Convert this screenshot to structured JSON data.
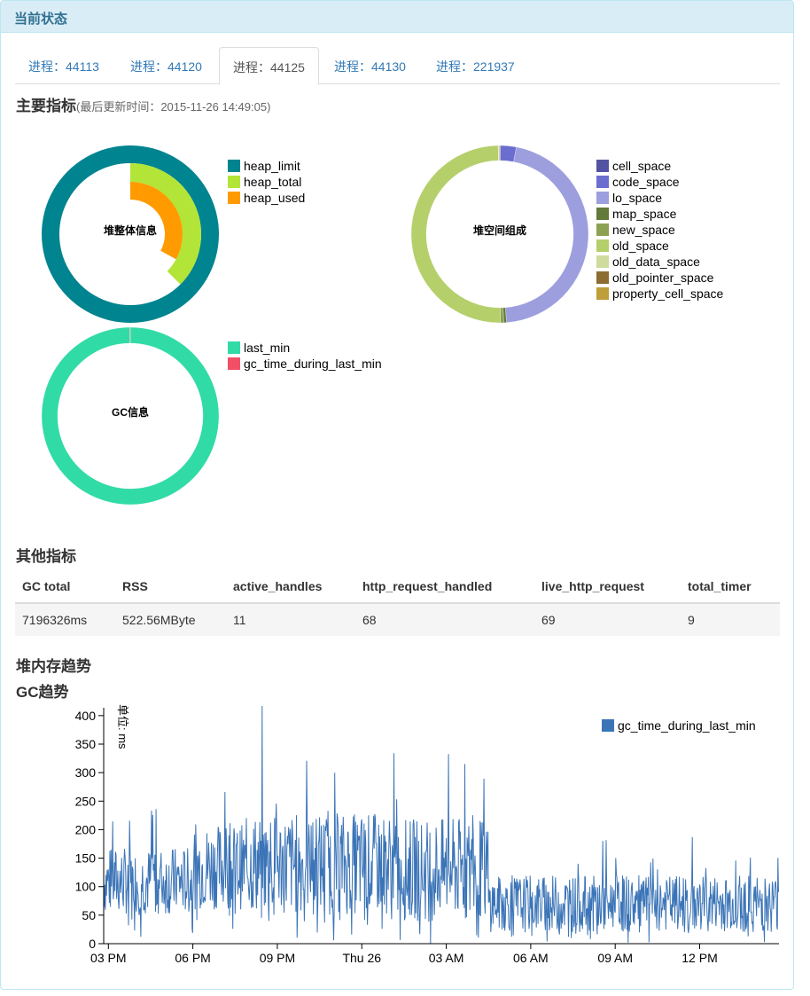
{
  "panel": {
    "title": "当前状态"
  },
  "tabs": [
    {
      "label": "进程：44113",
      "active": false
    },
    {
      "label": "进程：44120",
      "active": false
    },
    {
      "label": "进程：44125",
      "active": true
    },
    {
      "label": "进程：44130",
      "active": false
    },
    {
      "label": "进程：221937",
      "active": false
    }
  ],
  "main_metrics": {
    "title": "主要指标",
    "updated": "(最后更新时间：2015-11-26 14:49:05)"
  },
  "other_metrics": {
    "title": "其他指标",
    "columns": [
      "GC total",
      "RSS",
      "active_handles",
      "http_request_handled",
      "live_http_request",
      "total_timer"
    ],
    "row": [
      "7196326ms",
      "522.56MByte",
      "11",
      "68",
      "69",
      "9"
    ]
  },
  "heap_trend": {
    "title": "堆内存趋势"
  },
  "gc_trend": {
    "title": "GC趋势"
  },
  "chart_data": [
    {
      "type": "pie",
      "title": "堆整体信息",
      "legend_position": "right",
      "series": [
        {
          "name": "heap_limit",
          "values": [
            1.0
          ],
          "color": "#00848f"
        },
        {
          "name": "heap_total",
          "values": [
            0.375
          ],
          "color": "#b2e537"
        },
        {
          "name": "heap_used",
          "values": [
            0.33
          ],
          "color": "#ff9b00"
        }
      ]
    },
    {
      "type": "pie",
      "title": "堆空间组成",
      "legend_position": "right",
      "categories": [
        "cell_space",
        "code_space",
        "lo_space",
        "map_space",
        "new_space",
        "old_space",
        "old_data_space",
        "old_pointer_space",
        "property_cell_space"
      ],
      "values": [
        0.1,
        2.9,
        45.8,
        0.5,
        0.6,
        49.8,
        0.1,
        0.1,
        0.1
      ],
      "colors": [
        "#5254a3",
        "#6b6ecf",
        "#9c9ede",
        "#637939",
        "#8ca252",
        "#b5cf6b",
        "#cedb9c",
        "#8c6d31",
        "#bd9e39"
      ]
    },
    {
      "type": "pie",
      "title": "GC信息",
      "legend_position": "right",
      "categories": [
        "last_min",
        "gc_time_during_last_min"
      ],
      "values": [
        99.9,
        0.1
      ],
      "colors": [
        "#31dba5",
        "#f24f66"
      ]
    },
    {
      "type": "line",
      "title": "",
      "ylabel": "单位: ms",
      "ylim": [
        0,
        420
      ],
      "yticks": [
        0,
        50,
        100,
        150,
        200,
        250,
        300,
        350,
        400
      ],
      "xlim": [
        "2015-11-25 14:50",
        "2015-11-26 14:49"
      ],
      "xticks": [
        {
          "label": "03 PM",
          "t": "2015-11-25 15:00"
        },
        {
          "label": "06 PM",
          "t": "2015-11-25 18:00"
        },
        {
          "label": "09 PM",
          "t": "2015-11-25 21:00"
        },
        {
          "label": "Thu 26",
          "t": "2015-11-26 00:00"
        },
        {
          "label": "03 AM",
          "t": "2015-11-26 03:00"
        },
        {
          "label": "06 AM",
          "t": "2015-11-26 06:00"
        },
        {
          "label": "09 AM",
          "t": "2015-11-26 09:00"
        },
        {
          "label": "12 PM",
          "t": "2015-11-26 12:00"
        }
      ],
      "legend_position": "top-right",
      "series": [
        {
          "name": "gc_time_during_last_min",
          "color": "#3b74b7",
          "segments": [
            {
              "from": "2015-11-25 14:50",
              "to": "2015-11-25 18:00",
              "low": 50,
              "high": 170,
              "peak": 270
            },
            {
              "from": "2015-11-25 18:00",
              "to": "2015-11-25 20:00",
              "low": 60,
              "high": 210,
              "peak": 300
            },
            {
              "from": "2015-11-25 20:00",
              "to": "2015-11-26 01:00",
              "low": 50,
              "high": 230,
              "peak": 420
            },
            {
              "from": "2015-11-26 01:00",
              "to": "2015-11-26 04:30",
              "low": 40,
              "high": 220,
              "peak": 395
            },
            {
              "from": "2015-11-26 04:30",
              "to": "2015-11-26 14:49",
              "low": 20,
              "high": 120,
              "peak": 190
            }
          ]
        }
      ]
    }
  ]
}
